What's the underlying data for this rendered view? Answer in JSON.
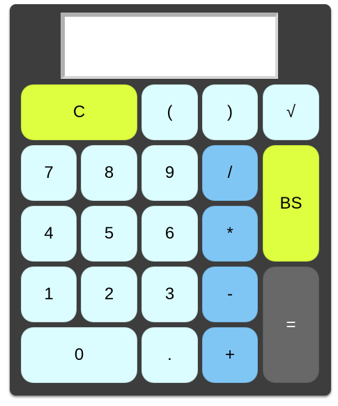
{
  "display": {
    "value": ""
  },
  "keys": {
    "clear": "C",
    "lparen": "(",
    "rparen": ")",
    "sqrt": "√",
    "seven": "7",
    "eight": "8",
    "nine": "9",
    "divide": "/",
    "backspace": "BS",
    "four": "4",
    "five": "5",
    "six": "6",
    "multiply": "*",
    "one": "1",
    "two": "2",
    "three": "3",
    "subtract": "-",
    "equals": "=",
    "zero": "0",
    "decimal": ".",
    "add": "+"
  },
  "colors": {
    "body": "#3d3d3d",
    "number_key": "#dcfdff",
    "operator_key": "#80c6f5",
    "function_key": "#ddff40",
    "equals_key": "#686868"
  }
}
